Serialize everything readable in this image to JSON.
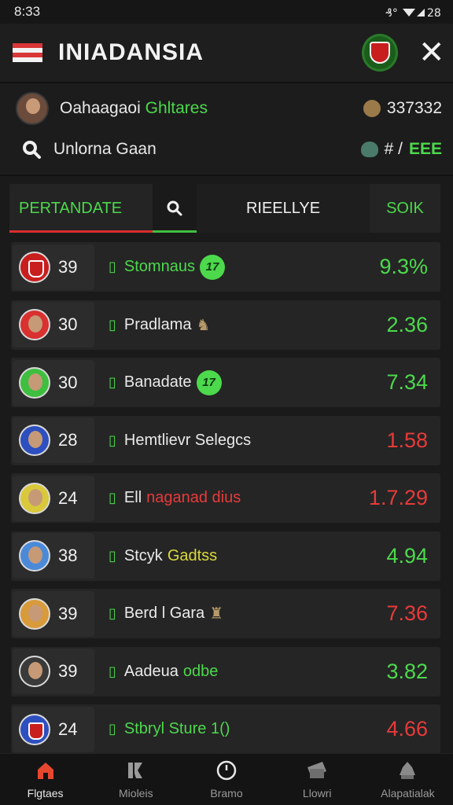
{
  "status": {
    "time": "8:33",
    "icons": "♪⁰ ▾◢ 28"
  },
  "header": {
    "title": "INIADANSIA",
    "close_icon": "✕",
    "flag_colors": [
      "#d93636",
      "#f2f2f2"
    ]
  },
  "info": {
    "user_name_plain": "Oahaagaoi",
    "user_name_green": "Ghltares",
    "user_score": "337332",
    "search_label": "Unlorna Gaan",
    "search_right_text": "# / ",
    "search_right_green": "EEE"
  },
  "tabs": [
    {
      "label": "PERTANDATE"
    },
    {
      "label": ""
    },
    {
      "label": "RIEELLYE"
    },
    {
      "label": "SOIK"
    }
  ],
  "rows": [
    {
      "rank": "39",
      "name": "Stomnaus",
      "name_color": "#4cd94c",
      "badge": "17",
      "value": "9.3%",
      "value_color": "#4cd94c",
      "avatar": "#c81e1e",
      "club": true
    },
    {
      "rank": "30",
      "name": "Pradlama",
      "name_color": "#eaeaea",
      "emoji": "♞",
      "value": "2.36",
      "value_color": "#4cd94c",
      "avatar": "#d93030"
    },
    {
      "rank": "30",
      "name": "Banadate",
      "name_color": "#eaeaea",
      "badge": "17",
      "value": "7.34",
      "value_color": "#4cd94c",
      "avatar": "#3fbf3f"
    },
    {
      "rank": "28",
      "name": "Hemtlievr Selegcs",
      "name_color": "#eaeaea",
      "value": "1.58",
      "value_color": "#e83a3a",
      "avatar": "#2d4fbf"
    },
    {
      "rank": "24",
      "name": "Ell",
      "name_suffix": "naganad dius",
      "name_color": "#eaeaea",
      "suffix_color": "#e83a3a",
      "value": "1.7.29",
      "value_color": "#e83a3a",
      "avatar": "#d9c93a"
    },
    {
      "rank": "38",
      "name": "Stcyk",
      "name_suffix": "Gadtss",
      "name_color": "#eaeaea",
      "suffix_color": "#d9d93a",
      "value": "4.94",
      "value_color": "#4cd94c",
      "avatar": "#4a8ad9"
    },
    {
      "rank": "39",
      "name": "Berd l Gara",
      "emoji": "♜",
      "name_color": "#eaeaea",
      "value": "7.36",
      "value_color": "#e83a3a",
      "avatar": "#d99a3a"
    },
    {
      "rank": "39",
      "name": "Aadeua",
      "name_suffix": "odbe",
      "name_color": "#eaeaea",
      "suffix_color": "#4cd94c",
      "value": "3.82",
      "value_color": "#4cd94c",
      "avatar": "#3a3a3a"
    },
    {
      "rank": "24",
      "name": "Stbryl Sture 1()",
      "name_color": "#4cd94c",
      "value": "4.66",
      "value_color": "#e83a3a",
      "avatar": "#2d4fbf",
      "club": true
    }
  ],
  "nav": [
    {
      "label": "Flgtaes",
      "icon": "home-icon",
      "active": true
    },
    {
      "label": "Mioleis",
      "icon": "stats-icon"
    },
    {
      "label": "Bramo",
      "icon": "clock-icon"
    },
    {
      "label": "Llowri",
      "icon": "ticket-icon"
    },
    {
      "label": "Alapatialak",
      "icon": "trophy-icon"
    }
  ]
}
